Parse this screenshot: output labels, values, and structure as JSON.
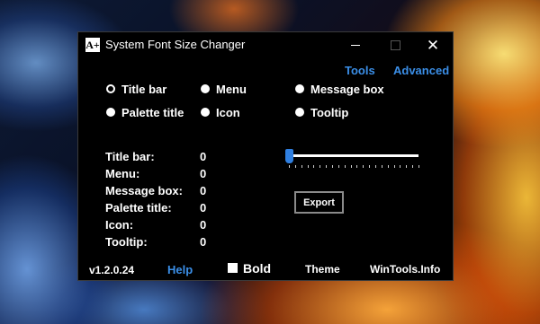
{
  "window": {
    "title": "System Font Size Changer",
    "icon_text": "A+"
  },
  "top_links": {
    "tools": "Tools",
    "advanced": "Advanced"
  },
  "radios": [
    {
      "label": "Title bar",
      "selected": true
    },
    {
      "label": "Menu",
      "selected": false
    },
    {
      "label": "Message box",
      "selected": false
    },
    {
      "label": "Palette title",
      "selected": false
    },
    {
      "label": "Icon",
      "selected": false
    },
    {
      "label": "Tooltip",
      "selected": false
    }
  ],
  "sizes": [
    {
      "label": "Title bar:",
      "value": "0"
    },
    {
      "label": "Menu:",
      "value": "0"
    },
    {
      "label": "Message box:",
      "value": "0"
    },
    {
      "label": "Palette title:",
      "value": "0"
    },
    {
      "label": "Icon:",
      "value": "0"
    },
    {
      "label": "Tooltip:",
      "value": "0"
    }
  ],
  "slider": {
    "value": 0
  },
  "export_label": "Export",
  "footer": {
    "version": "v1.2.0.24",
    "help": "Help",
    "bold_label": "Bold",
    "bold_checked": false,
    "theme": "Theme",
    "site": "WinTools.Info"
  },
  "colors": {
    "link": "#3b8fe8",
    "slider_thumb": "#2f7fe0",
    "window_bg": "#000000"
  },
  "icons": [
    "app-icon",
    "minimize-icon",
    "maximize-icon",
    "close-icon"
  ]
}
